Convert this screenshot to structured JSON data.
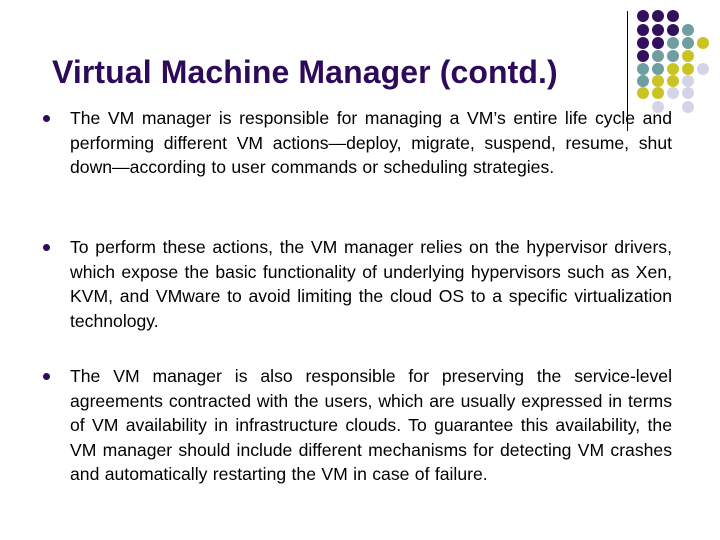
{
  "slide": {
    "title": "Virtual Machine Manager (contd.)",
    "colors": {
      "title": "#2d0a5a",
      "bullet": "#2d0a5a",
      "text": "#000000",
      "background": "#ffffff"
    },
    "bullets": [
      {
        "text": "The VM manager is responsible for managing a VM’s entire life cycle and performing different VM actions—deploy, migrate, suspend, resume, shut down—according to user commands or scheduling strategies."
      },
      {
        "text": "To perform these actions, the VM manager relies on the hypervisor drivers, which expose the basic functionality of underlying hypervisors such as Xen, KVM, and VMware to avoid limiting the cloud OS to a specific virtualization technology."
      },
      {
        "text": "The VM manager is also responsible for preserving the service-level agreements contracted with the users, which are usually expressed in terms of VM availability in infrastructure clouds. To guarantee this availability, the VM manager should include different mechanisms for detecting VM crashes and automatically restarting the VM in case of failure."
      }
    ]
  },
  "decoration": {
    "icon": "dot-grid-pattern",
    "palette": {
      "P": "#33105e",
      "T": "#6f9ea0",
      "Y": "#c9c424",
      "L": "#d4d4e8"
    },
    "grid_rows": [
      "PPP",
      "PPPT",
      "PPTTY",
      "PTTY",
      "TTYYL",
      "TYYL",
      "YYLL",
      ".L.L"
    ]
  }
}
